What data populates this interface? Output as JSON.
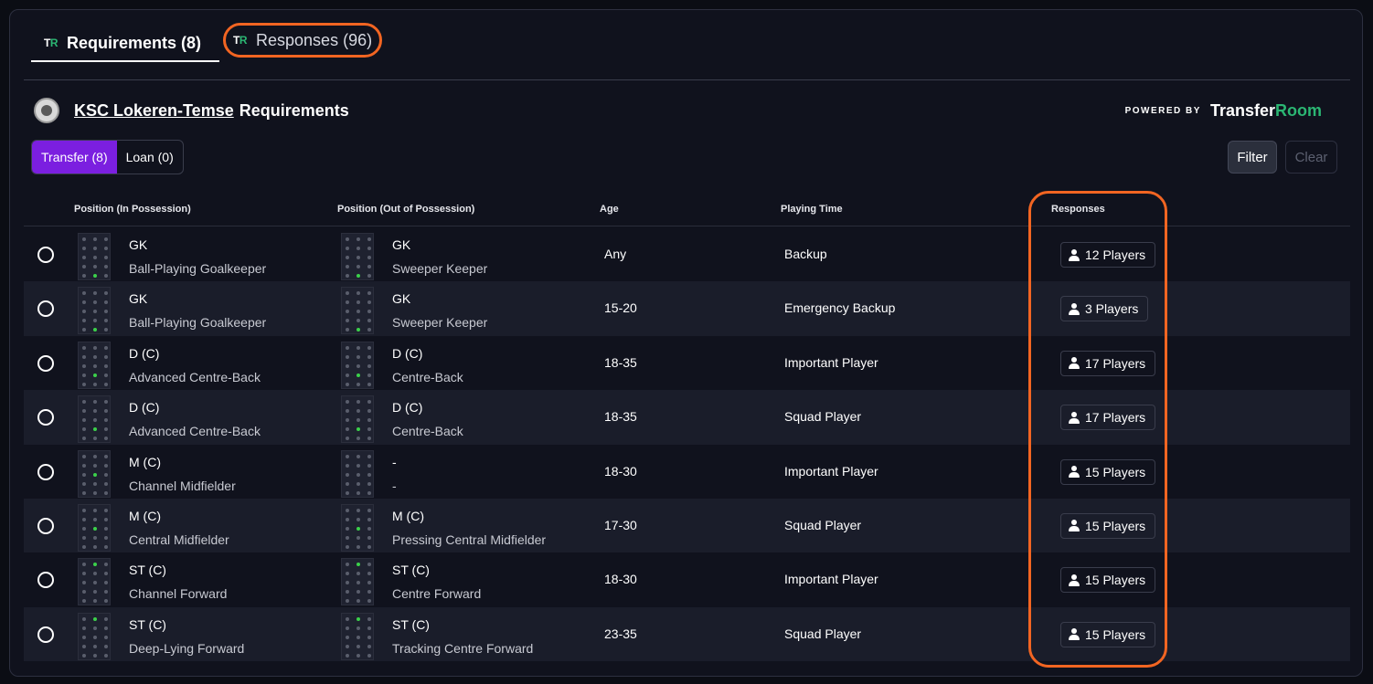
{
  "tabs": [
    {
      "logo_t": "T",
      "logo_r": "R",
      "label": "Requirements (8)",
      "active": true
    },
    {
      "logo_t": "T",
      "logo_r": "R",
      "label": "Responses (96)",
      "active": false
    }
  ],
  "header": {
    "club_name": "KSC Lokeren-Temse",
    "club_suffix": "Requirements",
    "powered_by": "POWERED BY",
    "brand_transfer": "Transfer",
    "brand_room": "Room"
  },
  "toggle": {
    "transfer": "Transfer (8)",
    "loan": "Loan (0)"
  },
  "actions": {
    "filter": "Filter",
    "clear": "Clear"
  },
  "columns": {
    "pos_in": "Position (In Possession)",
    "pos_out": "Position (Out of Possession)",
    "age": "Age",
    "playing_time": "Playing Time",
    "responses": "Responses"
  },
  "rows": [
    {
      "in_code": "GK",
      "in_role": "Ball-Playing Goalkeeper",
      "out_code": "GK",
      "out_role": "Sweeper Keeper",
      "age": "Any",
      "playing_time": "Backup",
      "responses": "12 Players",
      "in_slot": "gk",
      "out_slot": "gk"
    },
    {
      "in_code": "GK",
      "in_role": "Ball-Playing Goalkeeper",
      "out_code": "GK",
      "out_role": "Sweeper Keeper",
      "age": "15-20",
      "playing_time": "Emergency Backup",
      "responses": "3 Players",
      "in_slot": "gk",
      "out_slot": "gk"
    },
    {
      "in_code": "D (C)",
      "in_role": "Advanced Centre-Back",
      "out_code": "D (C)",
      "out_role": "Centre-Back",
      "age": "18-35",
      "playing_time": "Important Player",
      "responses": "17 Players",
      "in_slot": "dc",
      "out_slot": "dc"
    },
    {
      "in_code": "D (C)",
      "in_role": "Advanced Centre-Back",
      "out_code": "D (C)",
      "out_role": "Centre-Back",
      "age": "18-35",
      "playing_time": "Squad Player",
      "responses": "17 Players",
      "in_slot": "dc",
      "out_slot": "dc"
    },
    {
      "in_code": "M (C)",
      "in_role": "Channel Midfielder",
      "out_code": "-",
      "out_role": "-",
      "age": "18-30",
      "playing_time": "Important Player",
      "responses": "15 Players",
      "in_slot": "mc",
      "out_slot": "none"
    },
    {
      "in_code": "M (C)",
      "in_role": "Central Midfielder",
      "out_code": "M (C)",
      "out_role": "Pressing Central Midfielder",
      "age": "17-30",
      "playing_time": "Squad Player",
      "responses": "15 Players",
      "in_slot": "mc",
      "out_slot": "mc"
    },
    {
      "in_code": "ST (C)",
      "in_role": "Channel Forward",
      "out_code": "ST (C)",
      "out_role": "Centre Forward",
      "age": "18-30",
      "playing_time": "Important Player",
      "responses": "15 Players",
      "in_slot": "st",
      "out_slot": "st"
    },
    {
      "in_code": "ST (C)",
      "in_role": "Deep-Lying Forward",
      "out_code": "ST (C)",
      "out_role": "Tracking Centre Forward",
      "age": "23-35",
      "playing_time": "Squad Player",
      "responses": "15 Players",
      "in_slot": "st",
      "out_slot": "st"
    }
  ],
  "colors": {
    "accent_purple": "#7b1fe0",
    "brand_green": "#2bb673",
    "highlight_orange": "#f26522",
    "position_green": "#3bd14a"
  }
}
